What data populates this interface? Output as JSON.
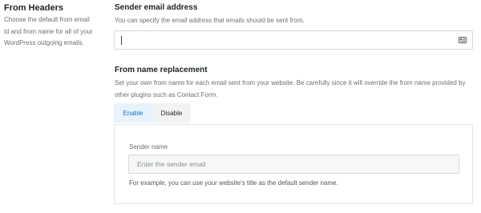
{
  "from_headers": {
    "title": "From Headers",
    "description": "Choose the default from email id and from name for all of your WordPress outgoing emails."
  },
  "sender_email": {
    "title": "Sender email address",
    "help": "You can specify the email address that emails should be sent from.",
    "value": "",
    "icon": "contact-card-icon"
  },
  "from_name": {
    "title": "From name replacement",
    "help": "Set your own from name for each email sent from your website. Be carefully since it will override the from name provided by other plugins such as Contact Form.",
    "toggle": {
      "enable_label": "Enable",
      "disable_label": "Disable",
      "selected": "Enable"
    }
  },
  "sender_name": {
    "label": "Sender name",
    "placeholder": "Enter the sender email",
    "help": "For example, you can use your website's title as the default sender name."
  },
  "colors": {
    "accent": "#2271b1",
    "active_bg": "#e6f2fd"
  }
}
